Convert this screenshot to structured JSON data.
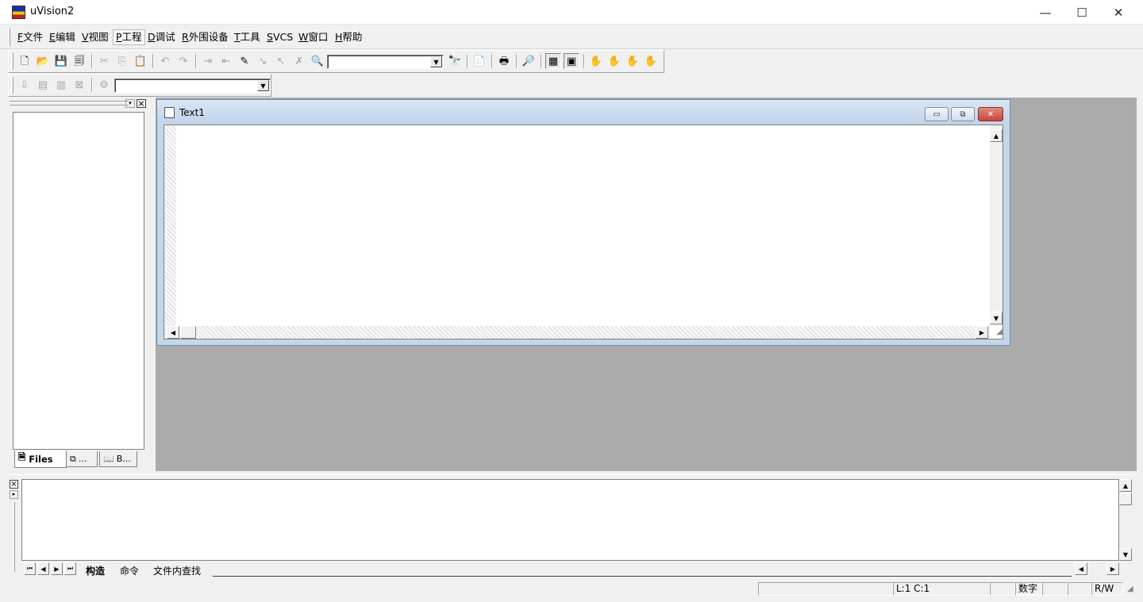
{
  "window": {
    "title": "uVision2",
    "minimize_label": "—",
    "maximize_label": "☐",
    "close_label": "✕"
  },
  "menu": {
    "items": [
      {
        "hotkey": "F",
        "label": "文件"
      },
      {
        "hotkey": "E",
        "label": "编辑"
      },
      {
        "hotkey": "V",
        "label": "视图"
      },
      {
        "hotkey": "P",
        "label": "工程"
      },
      {
        "hotkey": "D",
        "label": "调试"
      },
      {
        "hotkey": "R",
        "label": "外围设备"
      },
      {
        "hotkey": "T",
        "label": "工具"
      },
      {
        "hotkey": "S",
        "label": "VCS"
      },
      {
        "hotkey": "W",
        "label": "窗口"
      },
      {
        "hotkey": "H",
        "label": "帮助"
      }
    ],
    "active_index": 3
  },
  "toolbar1": {
    "icons": [
      "new-file-icon",
      "open-file-icon",
      "save-icon",
      "save-all-icon",
      "cut-icon",
      "copy-icon",
      "paste-icon",
      "undo-icon",
      "redo-icon",
      "indent-icon",
      "unindent-icon",
      "bookmark-icon",
      "next-bookmark-icon",
      "prev-bookmark-icon",
      "clear-bookmark-icon",
      "find-in-files-icon",
      "find-icon",
      "paste-special-icon",
      "print-icon",
      "zoom-icon",
      "workspace-icon",
      "output-window-icon",
      "hand-icon",
      "hand2-icon",
      "hand3-icon",
      "hand4-icon"
    ],
    "find_combo_value": ""
  },
  "toolbar2": {
    "icons": [
      "translate-icon",
      "build-icon",
      "rebuild-icon",
      "stop-build-icon",
      "options-icon"
    ],
    "target_combo_value": ""
  },
  "project_pane": {
    "tabs": [
      {
        "icon": "files-tab-icon",
        "label": "Files"
      },
      {
        "icon": "regs-tab-icon",
        "label": "..."
      },
      {
        "icon": "books-tab-icon",
        "label": "B..."
      }
    ],
    "close_label": "×"
  },
  "editor": {
    "title": "Text1",
    "content": "",
    "min_label": "▭",
    "max_label": "⧉",
    "close_label": "✕"
  },
  "output": {
    "tabs": [
      "构造",
      "命令",
      "文件内查找"
    ],
    "close_label": "×"
  },
  "status": {
    "position": "L:1 C:1",
    "num": "数字",
    "rw": "R/W"
  },
  "colors": {
    "mdi_background": "#ababab",
    "inner_title_gradient": "#c4d6ea",
    "close_button": "#c8453a"
  }
}
